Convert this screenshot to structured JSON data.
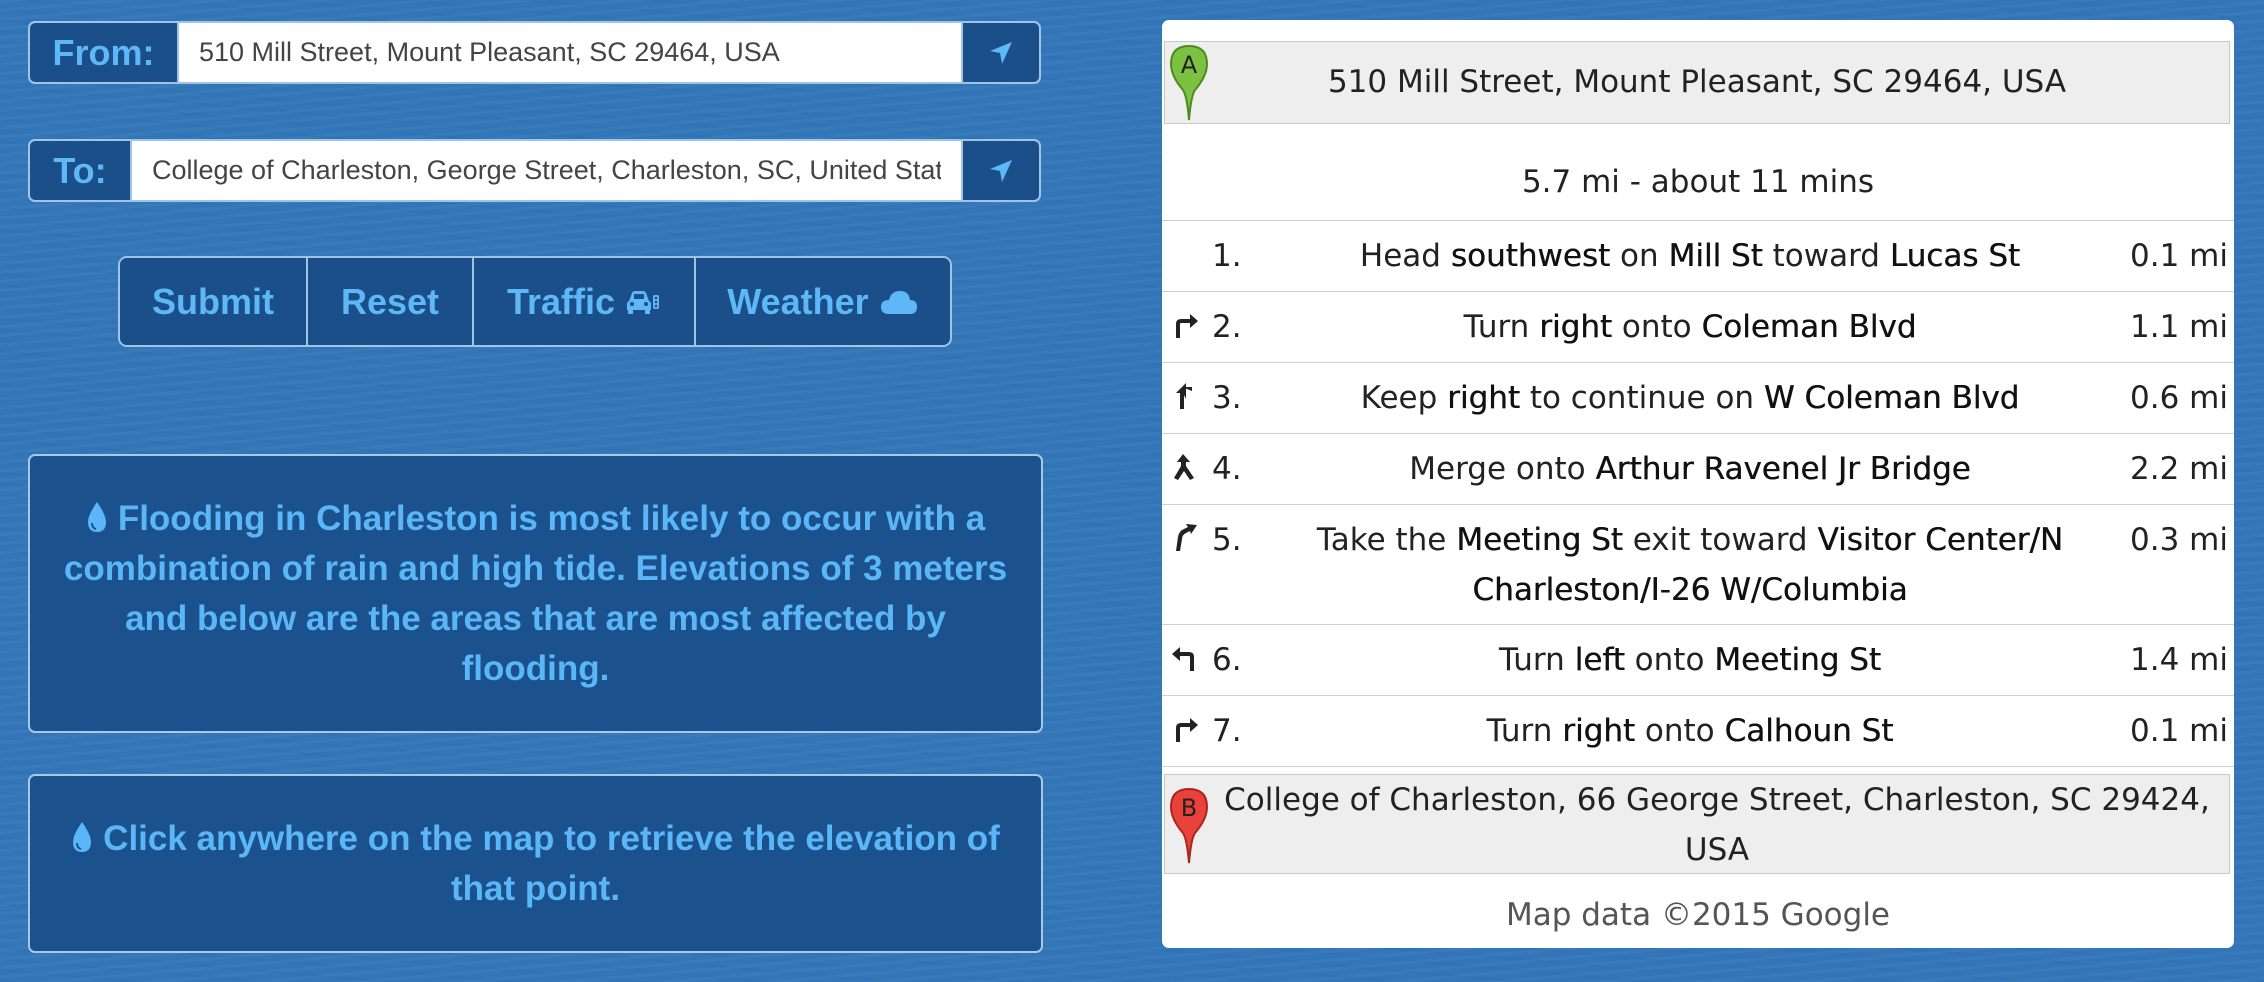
{
  "from": {
    "label": "From:",
    "value": "510 Mill Street, Mount Pleasant, SC 29464, USA",
    "locate_icon": "location-arrow-icon"
  },
  "to": {
    "label": "To:",
    "value": "College of Charleston, George Street, Charleston, SC, United States",
    "locate_icon": "location-arrow-icon"
  },
  "buttons": {
    "submit": "Submit",
    "reset": "Reset",
    "traffic": "Traffic",
    "traffic_icon": "car-traffic-icon",
    "weather": "Weather",
    "weather_icon": "cloud-icon"
  },
  "info": {
    "flooding": "Flooding in Charleston is most likely to occur with a combination of rain and high tide. Elevations of 3 meters and below are the areas that are most affected by flooding.",
    "click_tip": "Click anywhere on the map to retrieve the elevation of that point.",
    "icon": "water-drop-icon"
  },
  "directions": {
    "origin": {
      "marker": "A",
      "address": "510 Mill Street, Mount Pleasant, SC 29464, USA"
    },
    "summary": "5.7 mi - about 11 mins",
    "steps": [
      {
        "num": "1.",
        "icon": "",
        "parts": [
          "Head ",
          "southwest",
          " on ",
          "Mill St",
          " toward ",
          "Lucas St"
        ],
        "dist": "0.1 mi"
      },
      {
        "num": "2.",
        "icon": "turn-right-icon",
        "parts": [
          "Turn ",
          "right",
          " onto ",
          "Coleman Blvd"
        ],
        "dist": "1.1 mi"
      },
      {
        "num": "3.",
        "icon": "keep-right-icon",
        "parts": [
          "Keep ",
          "right",
          " to continue on ",
          "W Coleman Blvd"
        ],
        "dist": "0.6 mi"
      },
      {
        "num": "4.",
        "icon": "merge-icon",
        "parts": [
          "Merge onto ",
          "Arthur Ravenel Jr Bridge"
        ],
        "dist": "2.2 mi"
      },
      {
        "num": "5.",
        "icon": "ramp-right-icon",
        "parts": [
          "Take the ",
          "Meeting St",
          " exit toward ",
          "Visitor Center/N Charleston/I-26 W/Columbia"
        ],
        "dist": "0.3 mi"
      },
      {
        "num": "6.",
        "icon": "turn-left-icon",
        "parts": [
          "Turn ",
          "left",
          " onto ",
          "Meeting St"
        ],
        "dist": "1.4 mi"
      },
      {
        "num": "7.",
        "icon": "turn-right-icon",
        "parts": [
          "Turn ",
          "right",
          " onto ",
          "Calhoun St"
        ],
        "dist": "0.1 mi"
      }
    ],
    "destination": {
      "marker": "B",
      "address": "College of Charleston, 66 George Street, Charleston, SC 29424, USA"
    },
    "copyright": "Map data ©2015 Google"
  },
  "colors": {
    "panel": "#1b528d",
    "accent": "#5ab6f6",
    "marker_a": "#7cc242",
    "marker_b": "#e8423a"
  }
}
